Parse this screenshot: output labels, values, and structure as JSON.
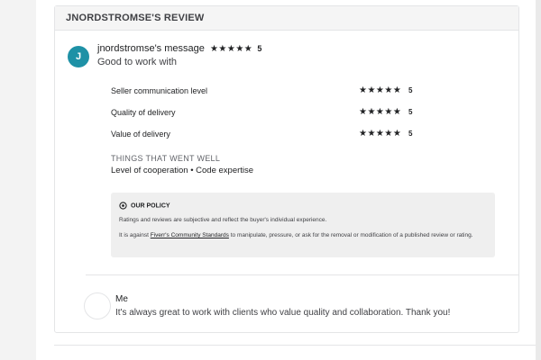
{
  "review": {
    "header": "JNORDSTROMSE'S REVIEW",
    "avatar_letter": "J",
    "avatar_color": "#1e91a6",
    "message_title": "jnordstromse's message",
    "overall_stars": "★★★★★",
    "overall_rating": "5",
    "message_body": "Good to work with",
    "ratings": [
      {
        "label": "Seller communication level",
        "stars": "★★★★★",
        "score": "5"
      },
      {
        "label": "Quality of delivery",
        "stars": "★★★★★",
        "score": "5"
      },
      {
        "label": "Value of delivery",
        "stars": "★★★★★",
        "score": "5"
      }
    ],
    "went_well_title": "THINGS THAT WENT WELL",
    "went_well_items": "Level of cooperation • Code expertise"
  },
  "policy": {
    "title": "OUR POLICY",
    "line1": "Ratings and reviews are subjective and reflect the buyer's individual experience.",
    "line2_prefix": "It is against ",
    "line2_link": "Fiverr's Community Standards",
    "line2_suffix": " to manipulate, pressure, or ask for the removal or modification of a published review or rating."
  },
  "reply": {
    "name": "Me",
    "text": "It's always great to work with clients who value quality and collaboration. Thank you!"
  }
}
